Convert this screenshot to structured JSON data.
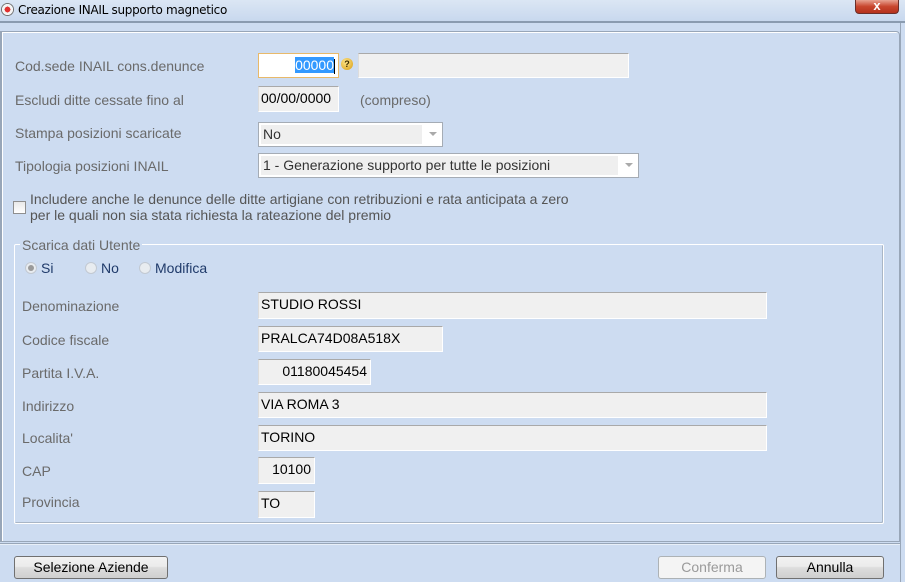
{
  "window": {
    "title": "Creazione INAIL supporto magnetico",
    "close_label": "x"
  },
  "form": {
    "cod_sede": {
      "label": "Cod.sede INAIL cons.denunce",
      "value": "00000",
      "description": ""
    },
    "escludi": {
      "label": "Escludi ditte cessate fino al",
      "value": "00/00/0000",
      "suffix": "(compreso)"
    },
    "stampa": {
      "label": "Stampa posizioni scaricate",
      "selected": "No"
    },
    "tipologia": {
      "label": "Tipologia posizioni INAIL",
      "selected": "1 - Generazione supporto per tutte le posizioni"
    },
    "includere": {
      "checked": false,
      "line1": "Includere anche le denunce delle ditte artigiane con retribuzioni e rata anticipata a zero",
      "line2": "per le quali non sia stata richiesta la rateazione del premio"
    }
  },
  "scarica": {
    "title": "Scarica dati Utente",
    "options": [
      {
        "label": "Si",
        "checked": true
      },
      {
        "label": "No",
        "checked": false
      },
      {
        "label": "Modifica",
        "checked": false
      }
    ],
    "fields": {
      "denominazione": {
        "label": "Denominazione",
        "value": "STUDIO ROSSI"
      },
      "codice_fiscale": {
        "label": "Codice fiscale",
        "value": "PRALCA74D08A518X"
      },
      "partita_iva": {
        "label": "Partita I.V.A.",
        "value": "01180045454"
      },
      "indirizzo": {
        "label": "Indirizzo",
        "value": "VIA ROMA 3"
      },
      "localita": {
        "label": "Localita'",
        "value": "TORINO"
      },
      "cap": {
        "label": "CAP",
        "value": "10100"
      },
      "provincia": {
        "label": "Provincia",
        "value": "TO"
      }
    }
  },
  "buttons": {
    "selezione_aziende": "Selezione Aziende",
    "conferma": "Conferma",
    "annulla": "Annulla"
  }
}
